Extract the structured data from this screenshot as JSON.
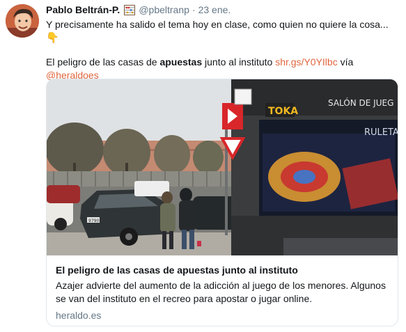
{
  "tweet": {
    "display_name": "Pablo Beltrán-P.",
    "handle": "@pbeltranp",
    "separator": "·",
    "time": "23 ene.",
    "line1": "Y precisamente ha salido el tema hoy en clase, como quien no quiere la cosa...",
    "emoji": "👇",
    "line2_prefix": "El peligro de las casas de ",
    "line2_bold": "apuestas",
    "line2_mid": " junto al instituto ",
    "line2_link": "shr.gs/Y0YIlbc",
    "line2_suffix": " vía",
    "mention": "@heraldoes"
  },
  "card": {
    "title": "El peligro de las casas de apuestas junto al instituto",
    "description": "Azajer advierte del aumento de la adicción al juego de los menores. Algunos se van del instituto en el recreo para apostar o jugar online.",
    "domain": "heraldo.es",
    "image": {
      "sign_toka": "TOKA",
      "sign_salon": "SALÓN DE JUEG",
      "sign_ruleta": "RULETA",
      "plate": "9790"
    }
  },
  "colors": {
    "link": "#e0663d",
    "secondary": "#657786",
    "border": "#e1e8ed"
  }
}
